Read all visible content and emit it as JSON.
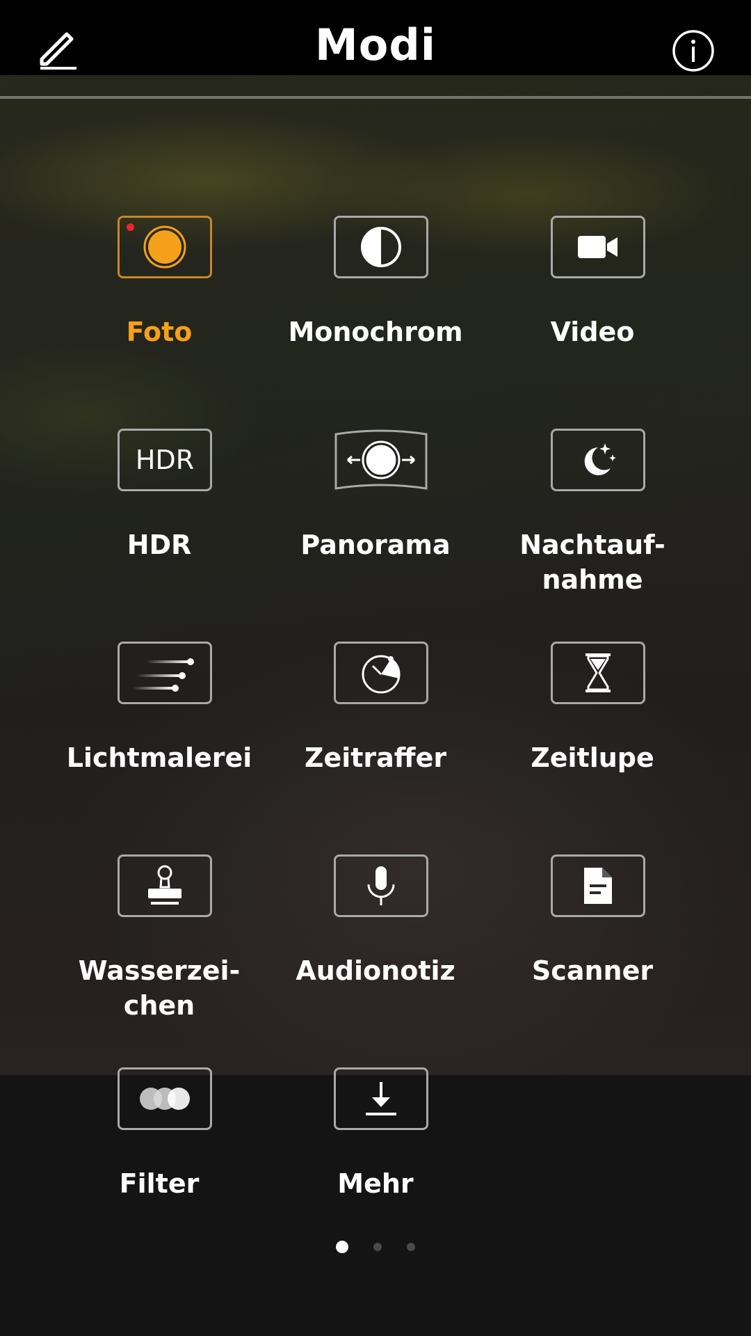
{
  "header": {
    "title": "Modi",
    "edit_icon": "pencil-icon",
    "info_icon": "info-icon"
  },
  "colors": {
    "accent": "#f5a01b",
    "recording_dot": "#e8262b",
    "border": "#a9a9a9"
  },
  "modes": [
    {
      "label": "Foto",
      "icon": "camera-photo-icon",
      "active": true
    },
    {
      "label": "Monochrom",
      "icon": "monochrome-icon"
    },
    {
      "label": "Video",
      "icon": "video-camera-icon"
    },
    {
      "label": "HDR",
      "icon": "hdr-icon",
      "icon_text": "HDR"
    },
    {
      "label": "Panorama",
      "icon": "panorama-icon"
    },
    {
      "label": "Nachtauf-\nnahme",
      "icon": "night-moon-icon"
    },
    {
      "label": "Lichtmalerei",
      "icon": "light-painting-icon"
    },
    {
      "label": "Zeitraffer",
      "icon": "timelapse-icon"
    },
    {
      "label": "Zeitlupe",
      "icon": "hourglass-icon"
    },
    {
      "label": "Wasserzei-\nchen",
      "icon": "watermark-stamp-icon"
    },
    {
      "label": "Audionotiz",
      "icon": "microphone-icon"
    },
    {
      "label": "Scanner",
      "icon": "document-icon"
    },
    {
      "label": "Filter",
      "icon": "filter-circles-icon"
    },
    {
      "label": "Mehr",
      "icon": "download-icon"
    }
  ],
  "pagination": {
    "pages": 3,
    "current": 1
  }
}
